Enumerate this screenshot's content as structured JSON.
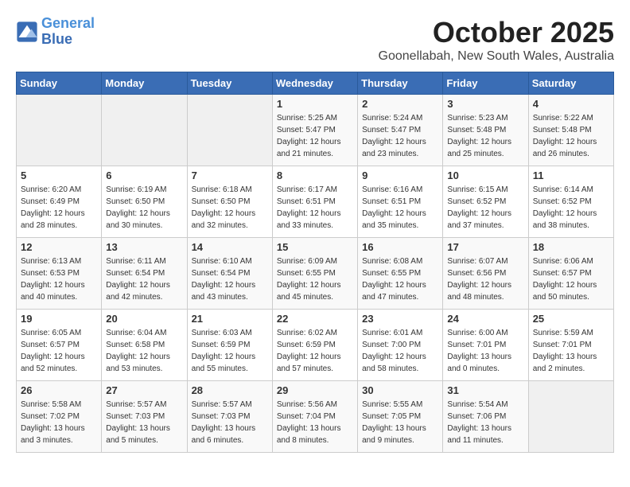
{
  "header": {
    "logo_line1": "General",
    "logo_line2": "Blue",
    "month": "October 2025",
    "location": "Goonellabah, New South Wales, Australia"
  },
  "weekdays": [
    "Sunday",
    "Monday",
    "Tuesday",
    "Wednesday",
    "Thursday",
    "Friday",
    "Saturday"
  ],
  "weeks": [
    [
      {
        "day": "",
        "info": ""
      },
      {
        "day": "",
        "info": ""
      },
      {
        "day": "",
        "info": ""
      },
      {
        "day": "1",
        "info": "Sunrise: 5:25 AM\nSunset: 5:47 PM\nDaylight: 12 hours\nand 21 minutes."
      },
      {
        "day": "2",
        "info": "Sunrise: 5:24 AM\nSunset: 5:47 PM\nDaylight: 12 hours\nand 23 minutes."
      },
      {
        "day": "3",
        "info": "Sunrise: 5:23 AM\nSunset: 5:48 PM\nDaylight: 12 hours\nand 25 minutes."
      },
      {
        "day": "4",
        "info": "Sunrise: 5:22 AM\nSunset: 5:48 PM\nDaylight: 12 hours\nand 26 minutes."
      }
    ],
    [
      {
        "day": "5",
        "info": "Sunrise: 6:20 AM\nSunset: 6:49 PM\nDaylight: 12 hours\nand 28 minutes."
      },
      {
        "day": "6",
        "info": "Sunrise: 6:19 AM\nSunset: 6:50 PM\nDaylight: 12 hours\nand 30 minutes."
      },
      {
        "day": "7",
        "info": "Sunrise: 6:18 AM\nSunset: 6:50 PM\nDaylight: 12 hours\nand 32 minutes."
      },
      {
        "day": "8",
        "info": "Sunrise: 6:17 AM\nSunset: 6:51 PM\nDaylight: 12 hours\nand 33 minutes."
      },
      {
        "day": "9",
        "info": "Sunrise: 6:16 AM\nSunset: 6:51 PM\nDaylight: 12 hours\nand 35 minutes."
      },
      {
        "day": "10",
        "info": "Sunrise: 6:15 AM\nSunset: 6:52 PM\nDaylight: 12 hours\nand 37 minutes."
      },
      {
        "day": "11",
        "info": "Sunrise: 6:14 AM\nSunset: 6:52 PM\nDaylight: 12 hours\nand 38 minutes."
      }
    ],
    [
      {
        "day": "12",
        "info": "Sunrise: 6:13 AM\nSunset: 6:53 PM\nDaylight: 12 hours\nand 40 minutes."
      },
      {
        "day": "13",
        "info": "Sunrise: 6:11 AM\nSunset: 6:54 PM\nDaylight: 12 hours\nand 42 minutes."
      },
      {
        "day": "14",
        "info": "Sunrise: 6:10 AM\nSunset: 6:54 PM\nDaylight: 12 hours\nand 43 minutes."
      },
      {
        "day": "15",
        "info": "Sunrise: 6:09 AM\nSunset: 6:55 PM\nDaylight: 12 hours\nand 45 minutes."
      },
      {
        "day": "16",
        "info": "Sunrise: 6:08 AM\nSunset: 6:55 PM\nDaylight: 12 hours\nand 47 minutes."
      },
      {
        "day": "17",
        "info": "Sunrise: 6:07 AM\nSunset: 6:56 PM\nDaylight: 12 hours\nand 48 minutes."
      },
      {
        "day": "18",
        "info": "Sunrise: 6:06 AM\nSunset: 6:57 PM\nDaylight: 12 hours\nand 50 minutes."
      }
    ],
    [
      {
        "day": "19",
        "info": "Sunrise: 6:05 AM\nSunset: 6:57 PM\nDaylight: 12 hours\nand 52 minutes."
      },
      {
        "day": "20",
        "info": "Sunrise: 6:04 AM\nSunset: 6:58 PM\nDaylight: 12 hours\nand 53 minutes."
      },
      {
        "day": "21",
        "info": "Sunrise: 6:03 AM\nSunset: 6:59 PM\nDaylight: 12 hours\nand 55 minutes."
      },
      {
        "day": "22",
        "info": "Sunrise: 6:02 AM\nSunset: 6:59 PM\nDaylight: 12 hours\nand 57 minutes."
      },
      {
        "day": "23",
        "info": "Sunrise: 6:01 AM\nSunset: 7:00 PM\nDaylight: 12 hours\nand 58 minutes."
      },
      {
        "day": "24",
        "info": "Sunrise: 6:00 AM\nSunset: 7:01 PM\nDaylight: 13 hours\nand 0 minutes."
      },
      {
        "day": "25",
        "info": "Sunrise: 5:59 AM\nSunset: 7:01 PM\nDaylight: 13 hours\nand 2 minutes."
      }
    ],
    [
      {
        "day": "26",
        "info": "Sunrise: 5:58 AM\nSunset: 7:02 PM\nDaylight: 13 hours\nand 3 minutes."
      },
      {
        "day": "27",
        "info": "Sunrise: 5:57 AM\nSunset: 7:03 PM\nDaylight: 13 hours\nand 5 minutes."
      },
      {
        "day": "28",
        "info": "Sunrise: 5:57 AM\nSunset: 7:03 PM\nDaylight: 13 hours\nand 6 minutes."
      },
      {
        "day": "29",
        "info": "Sunrise: 5:56 AM\nSunset: 7:04 PM\nDaylight: 13 hours\nand 8 minutes."
      },
      {
        "day": "30",
        "info": "Sunrise: 5:55 AM\nSunset: 7:05 PM\nDaylight: 13 hours\nand 9 minutes."
      },
      {
        "day": "31",
        "info": "Sunrise: 5:54 AM\nSunset: 7:06 PM\nDaylight: 13 hours\nand 11 minutes."
      },
      {
        "day": "",
        "info": ""
      }
    ]
  ]
}
